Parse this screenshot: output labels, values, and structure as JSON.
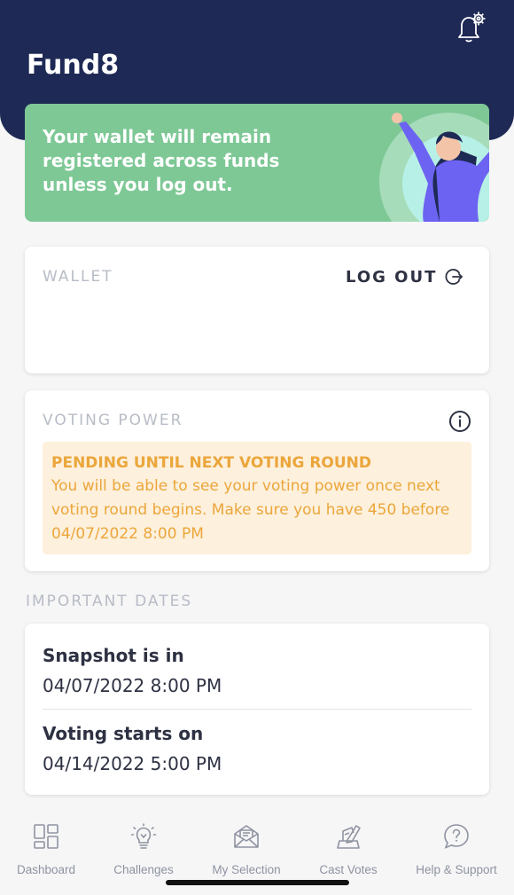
{
  "app": {
    "title": "Fund8"
  },
  "header": {
    "notification_icon": "bell-gear-icon"
  },
  "banner": {
    "message": "Your wallet will remain registered across funds unless you log out."
  },
  "wallet": {
    "label": "WALLET",
    "logout_label": "LOG OUT"
  },
  "voting": {
    "label": "VOTING POWER",
    "pending_title": "PENDING UNTIL NEXT VOTING ROUND",
    "pending_body": "You will be able to see your voting power once next voting round begins. Make sure you have 450 before 04/07/2022 8:00 PM"
  },
  "dates": {
    "section_label": "IMPORTANT DATES",
    "items": [
      {
        "title": "Snapshot is in",
        "value": "04/07/2022 8:00 PM"
      },
      {
        "title": "Voting starts on",
        "value": "04/14/2022 5:00 PM"
      }
    ]
  },
  "tabs": [
    {
      "label": "Dashboard",
      "icon": "dashboard-icon"
    },
    {
      "label": "Challenges",
      "icon": "lightbulb-icon"
    },
    {
      "label": "My Selection",
      "icon": "envelope-icon"
    },
    {
      "label": "Cast Votes",
      "icon": "ballot-icon"
    },
    {
      "label": "Help & Support",
      "icon": "question-bubble-icon"
    }
  ],
  "colors": {
    "header": "#1e2a55",
    "banner": "#7ec896",
    "pending_bg": "#fdf0dc",
    "pending_text": "#eba63b"
  }
}
